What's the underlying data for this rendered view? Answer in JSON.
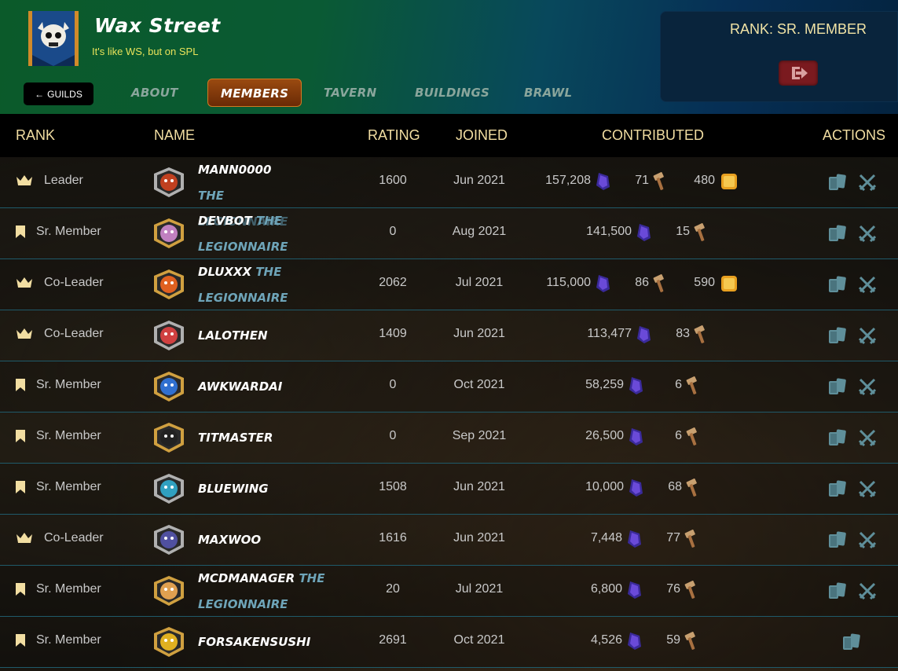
{
  "header": {
    "guild_name": "Wax Street",
    "motto": "It's like WS, but on SPL",
    "rank_text": "RANK: SR. MEMBER",
    "guilds_button": "GUILDS",
    "tabs": [
      {
        "label": "ABOUT",
        "active": false
      },
      {
        "label": "MEMBERS",
        "active": true
      },
      {
        "label": "TAVERN",
        "active": false
      },
      {
        "label": "BUILDINGS",
        "active": false
      },
      {
        "label": "BRAWL",
        "active": false
      }
    ]
  },
  "table": {
    "columns": [
      "RANK",
      "NAME",
      "RATING",
      "JOINED",
      "CONTRIBUTED",
      "ACTIONS"
    ],
    "rows": [
      {
        "rank": "Leader",
        "rank_icon": "crown-icon",
        "name": "MANN0000",
        "title": "THE LEGIONNAIRE",
        "rating": "1600",
        "joined": "Jun 2021",
        "dec": "157,208",
        "merits": "71",
        "extra": "480",
        "battle_action": true
      },
      {
        "rank": "Sr. Member",
        "rank_icon": "bookmark-icon",
        "name": "DEVBOT",
        "title": "THE LEGIONNAIRE",
        "rating": "0",
        "joined": "Aug 2021",
        "dec": "141,500",
        "merits": "15",
        "extra": "",
        "battle_action": true
      },
      {
        "rank": "Co-Leader",
        "rank_icon": "crown-icon",
        "name": "DLUXXX",
        "title": "THE LEGIONNAIRE",
        "rating": "2062",
        "joined": "Jul 2021",
        "dec": "115,000",
        "merits": "86",
        "extra": "590",
        "battle_action": true
      },
      {
        "rank": "Co-Leader",
        "rank_icon": "crown-icon",
        "name": "LALOTHEN",
        "title": "",
        "rating": "1409",
        "joined": "Jun 2021",
        "dec": "113,477",
        "merits": "83",
        "extra": "",
        "battle_action": true
      },
      {
        "rank": "Sr. Member",
        "rank_icon": "bookmark-icon",
        "name": "AWKWARDAI",
        "title": "",
        "rating": "0",
        "joined": "Oct 2021",
        "dec": "58,259",
        "merits": "6",
        "extra": "",
        "battle_action": true
      },
      {
        "rank": "Sr. Member",
        "rank_icon": "bookmark-icon",
        "name": "TITMASTER",
        "title": "",
        "rating": "0",
        "joined": "Sep 2021",
        "dec": "26,500",
        "merits": "6",
        "extra": "",
        "battle_action": true
      },
      {
        "rank": "Sr. Member",
        "rank_icon": "bookmark-icon",
        "name": "BLUEWING",
        "title": "",
        "rating": "1508",
        "joined": "Jun 2021",
        "dec": "10,000",
        "merits": "68",
        "extra": "",
        "battle_action": true
      },
      {
        "rank": "Co-Leader",
        "rank_icon": "crown-icon",
        "name": "MAXWOO",
        "title": "",
        "rating": "1616",
        "joined": "Jun 2021",
        "dec": "7,448",
        "merits": "77",
        "extra": "",
        "battle_action": true
      },
      {
        "rank": "Sr. Member",
        "rank_icon": "bookmark-icon",
        "name": "MCDMANAGER",
        "title": "THE LEGIONNAIRE",
        "rating": "20",
        "joined": "Jul 2021",
        "dec": "6,800",
        "merits": "76",
        "extra": "",
        "battle_action": true
      },
      {
        "rank": "Sr. Member",
        "rank_icon": "bookmark-icon",
        "name": "FORSAKENSUSHI",
        "title": "",
        "rating": "2691",
        "joined": "Oct 2021",
        "dec": "4,526",
        "merits": "59",
        "extra": "",
        "battle_action": false
      }
    ]
  },
  "colors": {
    "accent_gold": "#f2dea2",
    "active_tab": "#9a4a10",
    "title_blue": "#6ea4b8",
    "action_icon": "#5f8f9a"
  }
}
